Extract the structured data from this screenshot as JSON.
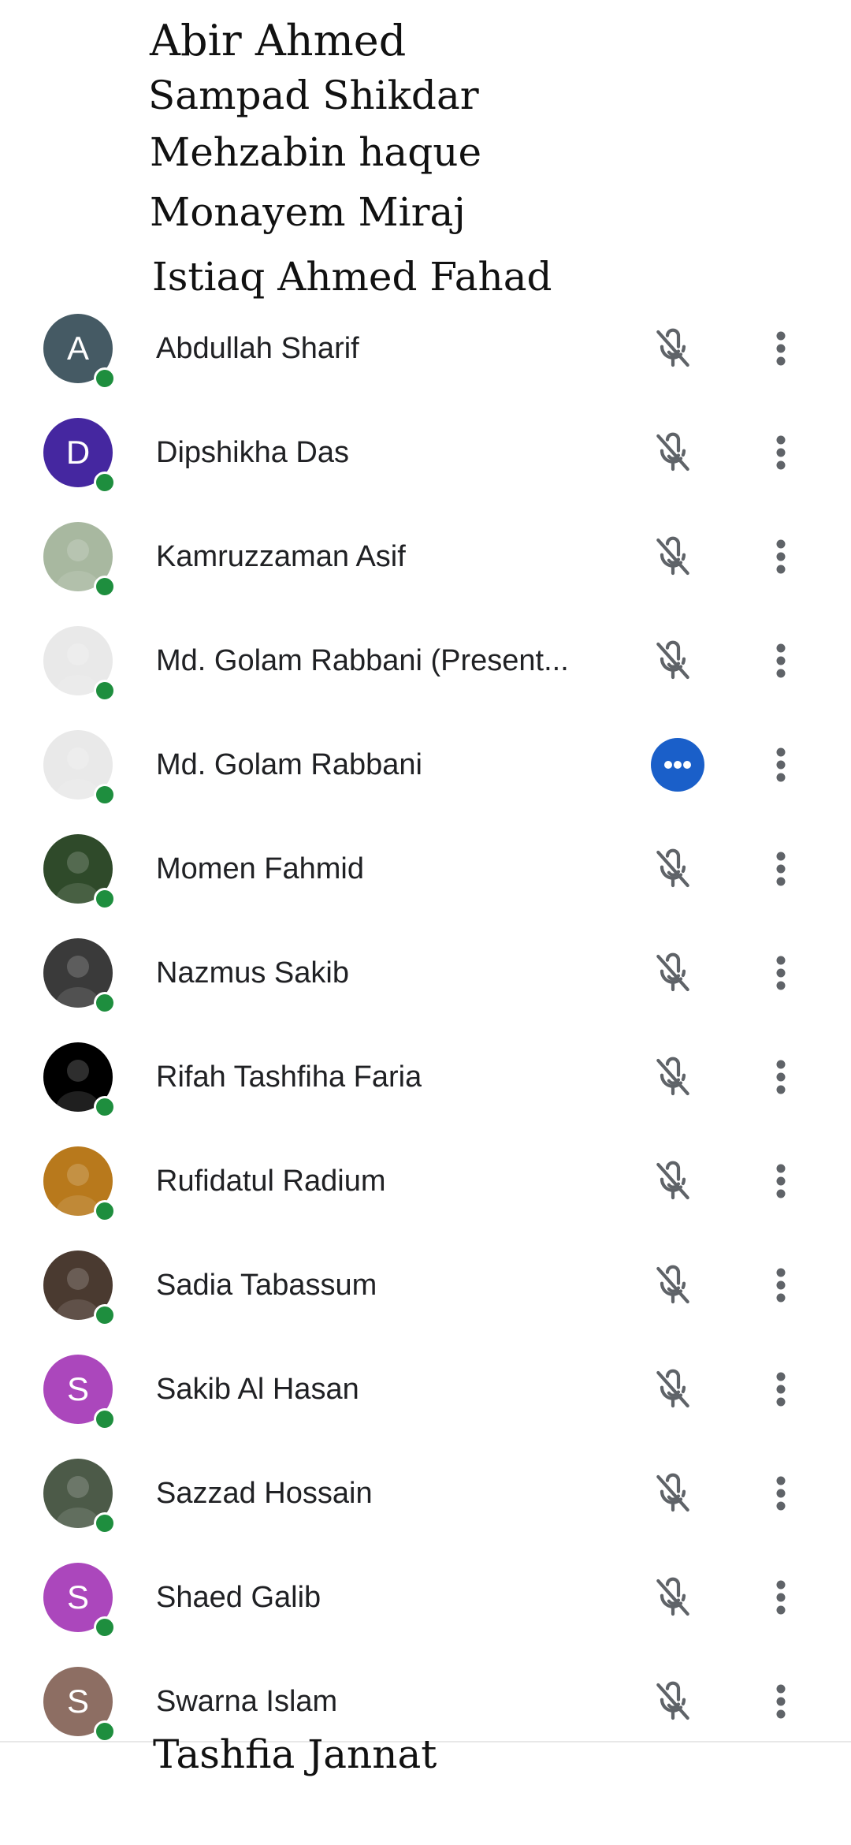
{
  "overlay_names": [
    "Abir Ahmed",
    "Sampad Shikdar",
    "Mehzabin haque",
    "Monayem Miraj",
    "Istiaq Ahmed Fahad",
    "Tashfia Jannat"
  ],
  "participants": [
    {
      "name": "Abdullah Sharif",
      "initial": "A",
      "avatar_color": "#455a64",
      "action": "mic-off-icon"
    },
    {
      "name": "Dipshikha Das",
      "initial": "D",
      "avatar_color": "#4527a0",
      "action": "mic-off-icon"
    },
    {
      "name": "Kamruzzaman Asif",
      "initial": "",
      "avatar_color": "#a8b8a0",
      "action": "mic-off-icon"
    },
    {
      "name": "Md. Golam Rabbani (Present...",
      "initial": "",
      "avatar_color": "#e9e9e9",
      "action": "mic-off-icon"
    },
    {
      "name": "Md. Golam Rabbani",
      "initial": "",
      "avatar_color": "#e9e9e9",
      "action": "speaking-indicator-icon"
    },
    {
      "name": "Momen Fahmid",
      "initial": "",
      "avatar_color": "#2f4a2a",
      "action": "mic-off-icon"
    },
    {
      "name": "Nazmus Sakib",
      "initial": "",
      "avatar_color": "#3a3a3a",
      "action": "mic-off-icon"
    },
    {
      "name": "Rifah Tashfiha Faria",
      "initial": "",
      "avatar_color": "#000000",
      "action": "mic-off-icon"
    },
    {
      "name": "Rufidatul Radium",
      "initial": "",
      "avatar_color": "#b8791c",
      "action": "mic-off-icon"
    },
    {
      "name": "Sadia Tabassum",
      "initial": "",
      "avatar_color": "#4a3a30",
      "action": "mic-off-icon"
    },
    {
      "name": "Sakib Al Hasan",
      "initial": "S",
      "avatar_color": "#ab47bc",
      "action": "mic-off-icon"
    },
    {
      "name": "Sazzad Hossain",
      "initial": "",
      "avatar_color": "#4c5a48",
      "action": "mic-off-icon"
    },
    {
      "name": "Shaed Galib",
      "initial": "S",
      "avatar_color": "#ab47bc",
      "action": "mic-off-icon"
    },
    {
      "name": "Swarna Islam",
      "initial": "S",
      "avatar_color": "#8d6e63",
      "action": "mic-off-icon"
    }
  ],
  "colors": {
    "online_status": "#1e8e3e",
    "speaking_accent": "#1a5fc9",
    "icon_gray": "#5f6368"
  }
}
